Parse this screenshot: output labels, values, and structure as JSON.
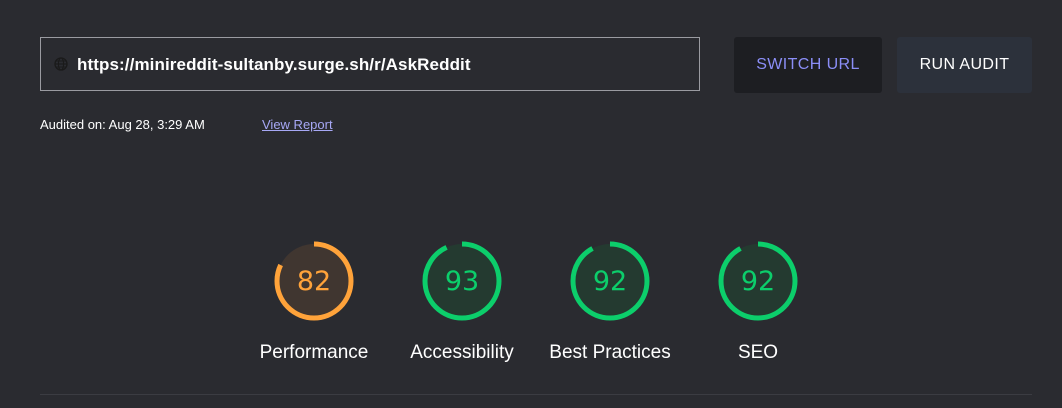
{
  "url_bar": {
    "url": "https://minireddit-sultanby.surge.sh/r/AskReddit",
    "icon": "globe-icon"
  },
  "buttons": {
    "switch_url": "SWITCH URL",
    "run_audit": "RUN AUDIT"
  },
  "audit_info": {
    "audited_on": "Audited on: Aug 28, 3:29 AM",
    "view_report": "View Report"
  },
  "colors": {
    "background": "#2a2b30",
    "orange": "#ffa33a",
    "green": "#0cce6b",
    "switch_url_text": "#8b8ef7"
  },
  "gauges": [
    {
      "label": "Performance",
      "score": "82",
      "value": 82,
      "status": "average"
    },
    {
      "label": "Accessibility",
      "score": "93",
      "value": 93,
      "status": "pass"
    },
    {
      "label": "Best Practices",
      "score": "92",
      "value": 92,
      "status": "pass"
    },
    {
      "label": "SEO",
      "score": "92",
      "value": 92,
      "status": "pass"
    }
  ]
}
